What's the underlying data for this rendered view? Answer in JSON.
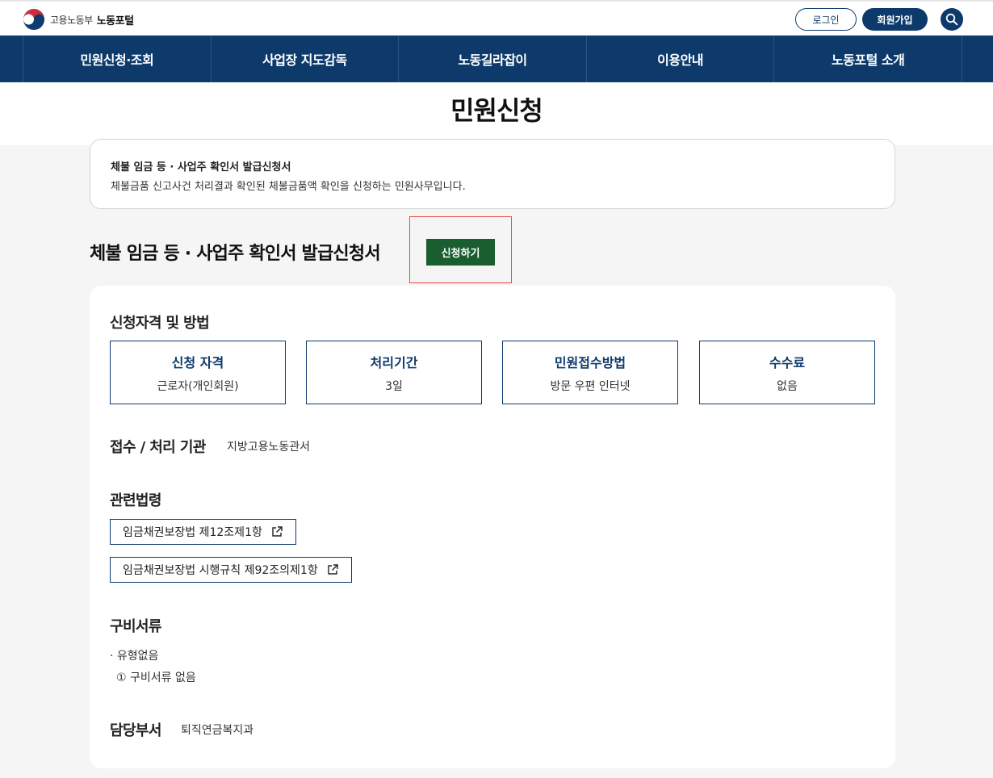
{
  "header": {
    "ministry": "고용노동부",
    "portal": "노동포털",
    "login_label": "로그인",
    "join_label": "회원가입"
  },
  "nav": {
    "items": [
      "민원신청·조회",
      "사업장 지도감독",
      "노동길라잡이",
      "이용안내",
      "노동포털 소개"
    ]
  },
  "page": {
    "title": "민원신청"
  },
  "summary": {
    "title": "체불 임금 등 · 사업주 확인서 발급신청서",
    "description": "체불금품 신고사건 처리결과 확인된 체불금품액 확인을 신청하는 민원사무입니다."
  },
  "main": {
    "heading": "체불 임금 등 · 사업주 확인서 발급신청서",
    "apply_label": "신청하기"
  },
  "qualification": {
    "heading": "신청자격 및 방법",
    "boxes": [
      {
        "label": "신청 자격",
        "value": "근로자(개인회원)"
      },
      {
        "label": "처리기간",
        "value": "3일"
      },
      {
        "label": "민원접수방법",
        "value": "방문 우편 인터넷"
      },
      {
        "label": "수수료",
        "value": "없음"
      }
    ]
  },
  "agency": {
    "heading": "접수 / 처리 기관",
    "value": "지방고용노동관서"
  },
  "laws": {
    "heading": "관련법령",
    "items": [
      "임금채권보장법 제12조제1항",
      "임금채권보장법 시행규칙 제92조의제1항"
    ]
  },
  "documents": {
    "heading": "구비서류",
    "type": "· 유형없음",
    "item": "① 구비서류 없음"
  },
  "department": {
    "heading": "담당부서",
    "value": "퇴직연금복지과"
  },
  "colors": {
    "primary": "#0d3a6b",
    "apply_button": "#1a5e30",
    "highlight": "#e84a4a"
  },
  "icons": [
    "taeguk-logo-icon",
    "search-icon",
    "external-link-icon"
  ]
}
